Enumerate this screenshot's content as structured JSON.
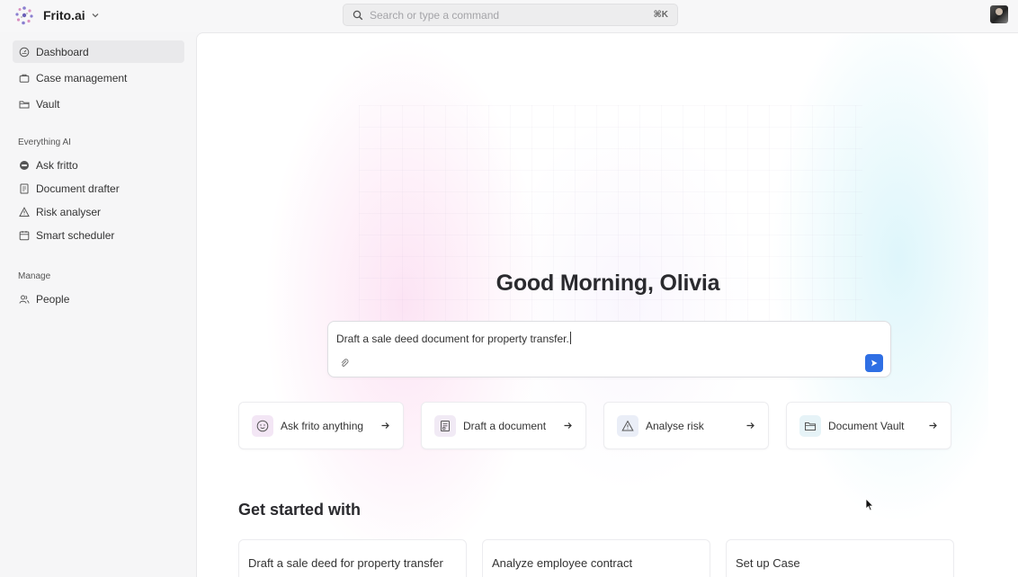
{
  "app": {
    "name": "Frito.ai"
  },
  "search": {
    "placeholder": "Search or type a command",
    "shortcut": "⌘K"
  },
  "sidebar": {
    "items": [
      {
        "label": "Dashboard",
        "icon": "dashboard-icon",
        "active": true
      },
      {
        "label": "Case management",
        "icon": "briefcase-icon"
      },
      {
        "label": "Vault",
        "icon": "folder-icon"
      }
    ],
    "sections": [
      {
        "title": "Everything AI",
        "items": [
          {
            "label": "Ask fritto",
            "icon": "chat-icon"
          },
          {
            "label": "Document drafter",
            "icon": "document-icon"
          },
          {
            "label": "Risk analyser",
            "icon": "warning-icon"
          },
          {
            "label": "Smart scheduler",
            "icon": "calendar-icon"
          }
        ]
      },
      {
        "title": "Manage",
        "items": [
          {
            "label": "People",
            "icon": "people-icon"
          }
        ]
      }
    ]
  },
  "main": {
    "greeting": "Good Morning, Olivia",
    "prompt": {
      "value": "Draft a sale deed document for property transfer."
    },
    "quick_actions": [
      {
        "label": "Ask frito anything",
        "icon": "smiley-icon"
      },
      {
        "label": "Draft a document",
        "icon": "document-icon"
      },
      {
        "label": "Analyse risk",
        "icon": "warning-icon"
      },
      {
        "label": "Document Vault",
        "icon": "folder-icon"
      }
    ],
    "get_started": {
      "title": "Get started with",
      "cards": [
        {
          "label": "Draft a sale deed for property transfer"
        },
        {
          "label": "Analyze employee contract"
        },
        {
          "label": "Set up Case"
        }
      ]
    }
  },
  "colors": {
    "accent": "#2f6fe4",
    "pink_glow": "#facdeb",
    "cyan_glow": "#c8f0f8"
  }
}
